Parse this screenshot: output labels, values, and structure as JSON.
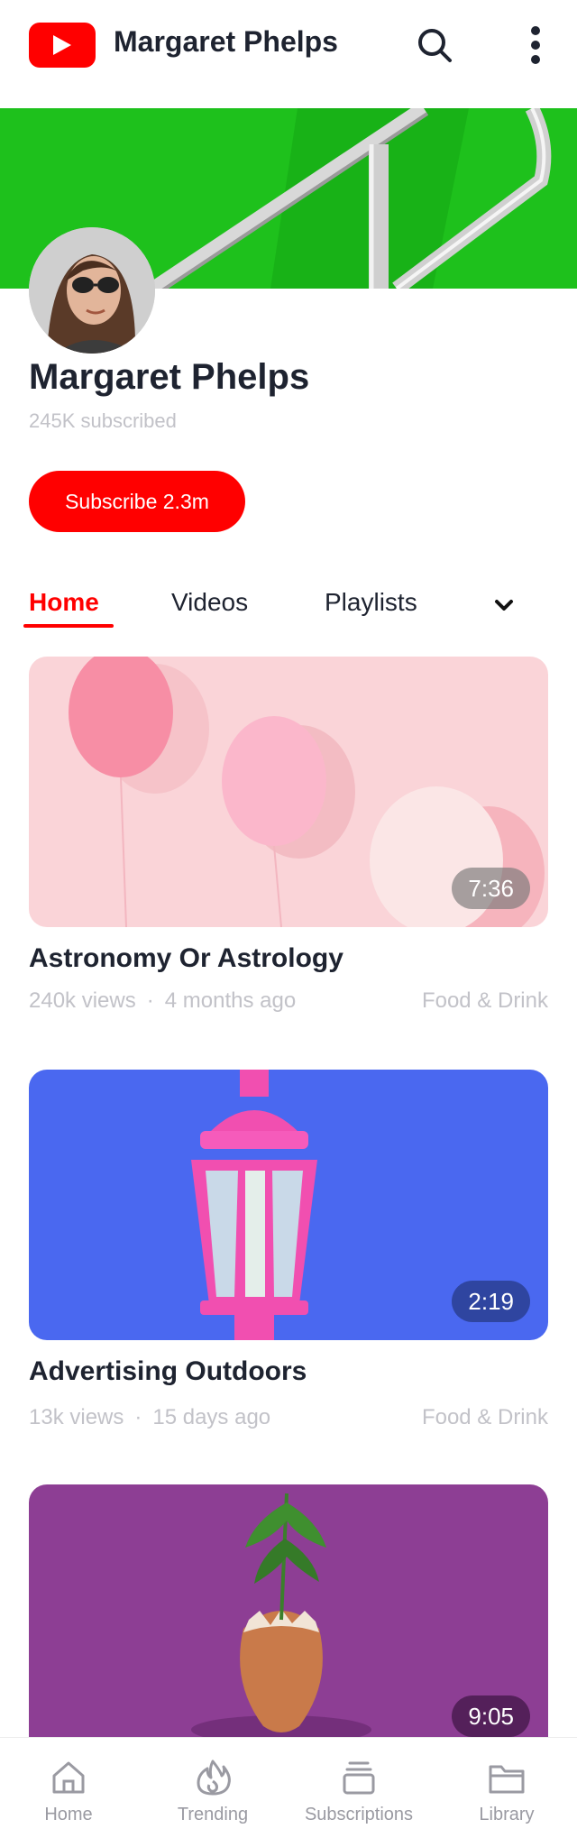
{
  "header": {
    "title": "Margaret Phelps",
    "logo_icon": "youtube-logo-icon",
    "search_icon": "search-icon",
    "more_icon": "more-vertical-icon"
  },
  "channel": {
    "name": "Margaret Phelps",
    "subscribers": "245K subscribed",
    "subscribe_label": "Subscribe 2.3m"
  },
  "tabs": [
    {
      "label": "Home",
      "active": true
    },
    {
      "label": "Videos",
      "active": false
    },
    {
      "label": "Playlists",
      "active": false
    }
  ],
  "videos": [
    {
      "title": "Astronomy Or Astrology",
      "views": "240k views",
      "age": "4 months ago",
      "category": "Food & Drink",
      "duration": "7:36"
    },
    {
      "title": "Advertising Outdoors",
      "views": "13k views",
      "age": "15 days ago",
      "category": "Food & Drink",
      "duration": "2:19"
    },
    {
      "title": "",
      "views": "",
      "age": "",
      "category": "",
      "duration": "9:05"
    }
  ],
  "meta_separator": "·",
  "bottom_nav": [
    {
      "label": "Home",
      "icon": "home-icon"
    },
    {
      "label": "Trending",
      "icon": "flame-icon"
    },
    {
      "label": "Subscriptions",
      "icon": "subscriptions-icon"
    },
    {
      "label": "Library",
      "icon": "folder-icon"
    }
  ],
  "colors": {
    "accent": "#ff0000",
    "text": "#1e2330",
    "muted": "#c2c2c8",
    "banner_green": "#1ec81e",
    "thumb_pink": "#fad4d8",
    "thumb_blue": "#4a68f0",
    "thumb_purple": "#8d3e94"
  }
}
